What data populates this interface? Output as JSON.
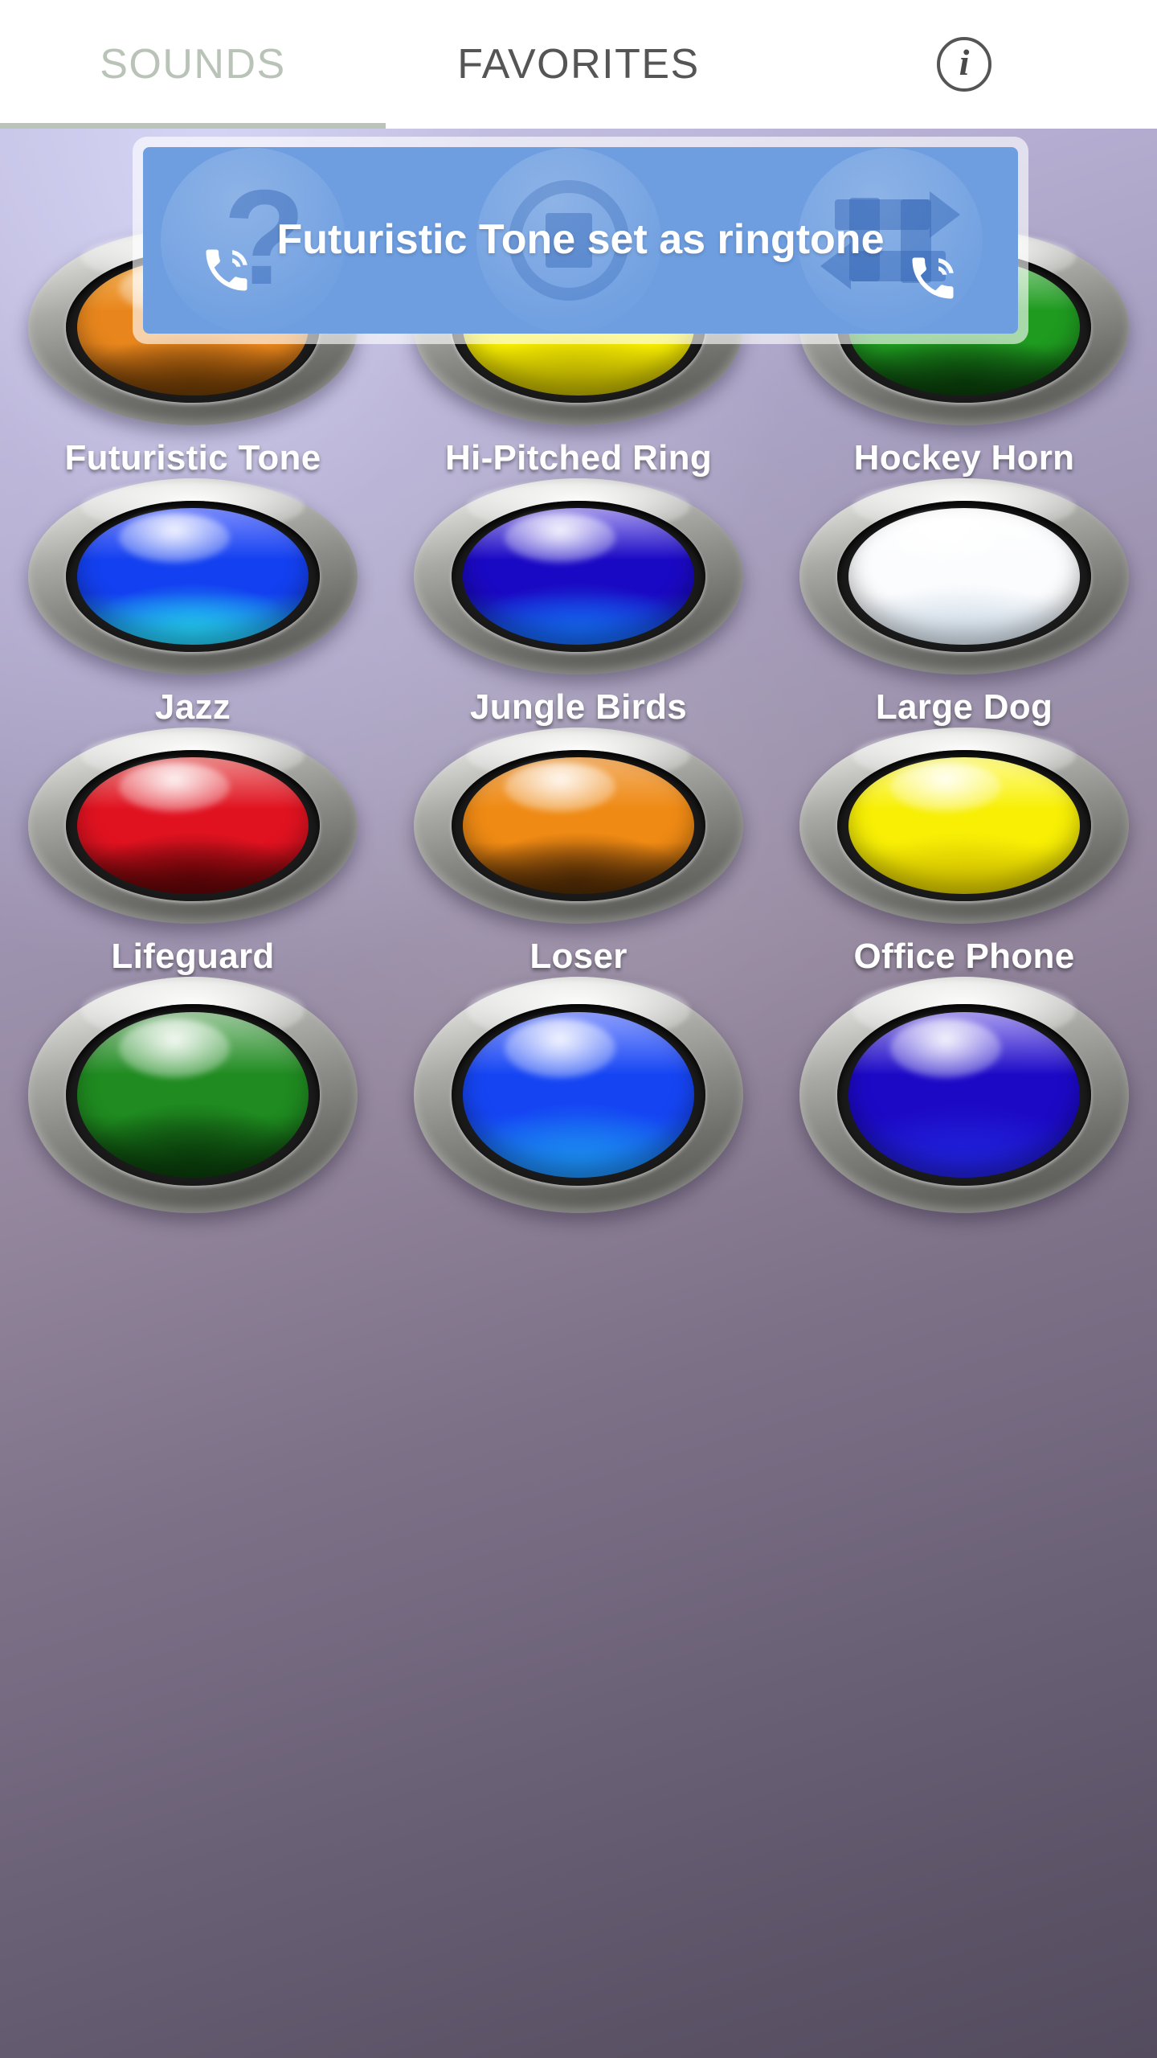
{
  "tabs": [
    {
      "id": "sounds",
      "label": "SOUNDS",
      "active": false
    },
    {
      "id": "favorites",
      "label": "FAVORITES",
      "active": true
    }
  ],
  "header": {
    "info_icon": "info-icon",
    "info_glyph": "i"
  },
  "toast": {
    "message": "Futuristic Tone set as ringtone",
    "background_color": "#6E9EE0",
    "text_color": "#FFFFFF",
    "ghost_icons": [
      "question-phone-icon",
      "stop-icon",
      "repeat-phone-icon"
    ]
  },
  "theme": {
    "background_top": "#C9C7EA",
    "background_bottom": "#534B5E",
    "label_color": "#FFFFFF",
    "tab_active_color": "#555555",
    "tab_inactive_color": "#B9C3B8",
    "bezel_light": "#F3F3F1",
    "bezel_dark": "#5C5C58"
  },
  "sounds": [
    {
      "label": "Futuristic Tone",
      "color_name": "orange",
      "hi": "#f7b85c",
      "mid": "#e8861d",
      "lo": "#6b3a06"
    },
    {
      "label": "Hi-Pitched Ring",
      "color_name": "yellow",
      "hi": "#fffb8a",
      "mid": "#f6ec00",
      "lo": "#b9ae00"
    },
    {
      "label": "Hockey Horn",
      "color_name": "green",
      "hi": "#8fd18f",
      "mid": "#1f9b20",
      "lo": "#0a3c0b"
    },
    {
      "label": "Jazz",
      "color_name": "blue",
      "hi": "#7b8cff",
      "mid": "#1340f0",
      "lo": "#23c8ef"
    },
    {
      "label": "Jungle Birds",
      "color_name": "dark-blue",
      "hi": "#a79bf0",
      "mid": "#1a09c4",
      "lo": "#1466ef"
    },
    {
      "label": "Large Dog",
      "color_name": "white",
      "hi": "#ffffff",
      "mid": "#fbfcfe",
      "lo": "#d7e2ec"
    },
    {
      "label": "Lifeguard",
      "color_name": "red",
      "hi": "#ef8a8a",
      "mid": "#e01220",
      "lo": "#5f0508"
    },
    {
      "label": "Loser",
      "color_name": "orange",
      "hi": "#f3b26a",
      "mid": "#ef8a14",
      "lo": "#4f2a05"
    },
    {
      "label": "Office Phone",
      "color_name": "yellow",
      "hi": "#fffc8e",
      "mid": "#f8ef05",
      "lo": "#d8c800"
    },
    {
      "label": "",
      "color_name": "green",
      "hi": "#9fcb9f",
      "mid": "#1f8b20",
      "lo": "#0a3c0b"
    },
    {
      "label": "",
      "color_name": "blue",
      "hi": "#8fa0ff",
      "mid": "#1545f3",
      "lo": "#1b8bf0"
    },
    {
      "label": "",
      "color_name": "indigo",
      "hi": "#a99df2",
      "mid": "#1c09c6",
      "lo": "#2020d8"
    }
  ]
}
